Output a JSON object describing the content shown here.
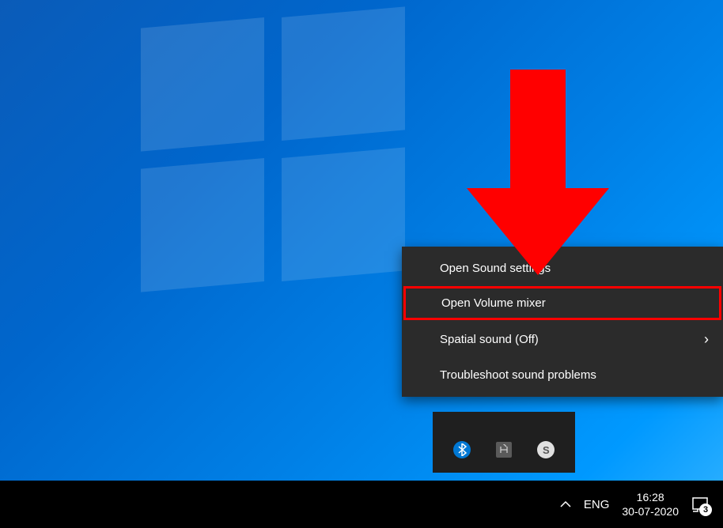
{
  "contextMenu": {
    "items": [
      {
        "label": "Open Sound settings",
        "hasSubmenu": false
      },
      {
        "label": "Open Volume mixer",
        "hasSubmenu": false,
        "highlighted": true
      },
      {
        "label": "Spatial sound (Off)",
        "hasSubmenu": true
      },
      {
        "label": "Troubleshoot sound problems",
        "hasSubmenu": false
      }
    ]
  },
  "taskbar": {
    "language": "ENG",
    "time": "16:28",
    "date": "30-07-2020",
    "notificationCount": "3"
  },
  "trayIcons": {
    "bluetooth": "bluetooth",
    "app": "H",
    "skype": "S"
  }
}
